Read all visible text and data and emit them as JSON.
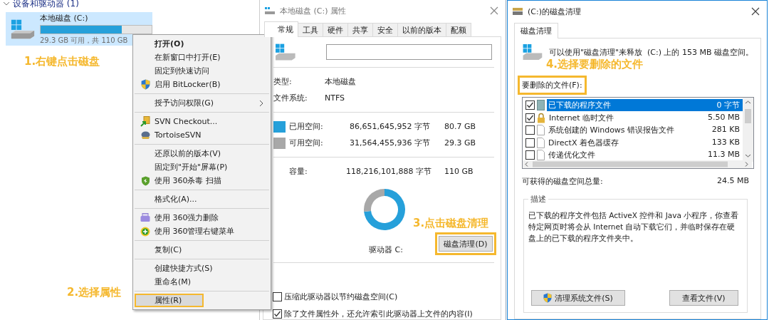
{
  "explorer": {
    "section_title": "设备和驱动器 (1)",
    "drive": {
      "name": "本地磁盘 (C:)",
      "level": 0.73,
      "space_text": "29.3 GB 可用，共 110 GB",
      "selected": true
    },
    "annotation": "1.右键点击磁盘"
  },
  "context_menu": {
    "annotation": "2.选择属性",
    "items": [
      {
        "kind": "plain",
        "label": "打开(O)",
        "bold": true,
        "selected": false
      },
      {
        "kind": "plain",
        "label": "在新窗口中打开(E)",
        "bold": false,
        "selected": false
      },
      {
        "kind": "plain",
        "label": "固定到快速访问",
        "bold": false,
        "selected": false
      },
      {
        "kind": "shield",
        "label": "启用 BitLocker(B)",
        "bold": false,
        "selected": false
      },
      {
        "kind": "separator"
      },
      {
        "kind": "submenu",
        "label": "授予访问权限(G)",
        "bold": false,
        "selected": false
      },
      {
        "kind": "separator"
      },
      {
        "kind": "checkout",
        "label": "SVN Checkout...",
        "bold": false,
        "selected": false
      },
      {
        "kind": "tortoise",
        "label": "TortoiseSVN",
        "bold": false,
        "selected": false
      },
      {
        "kind": "separator"
      },
      {
        "kind": "plain",
        "label": "还原以前的版本(V)",
        "bold": false,
        "selected": false
      },
      {
        "kind": "plain",
        "label": "固定到\"开始\"屏幕(P)",
        "bold": false,
        "selected": false
      },
      {
        "kind": "antivirus",
        "label": "使用 360杀毒 扫描",
        "bold": false,
        "selected": false
      },
      {
        "kind": "separator"
      },
      {
        "kind": "plain",
        "label": "格式化(A)...",
        "bold": false,
        "selected": false
      },
      {
        "kind": "separator"
      },
      {
        "kind": "shredder",
        "label": "使用 360强力删除",
        "bold": false,
        "selected": false
      },
      {
        "kind": "manager",
        "label": "使用 360管理右键菜单",
        "bold": false,
        "selected": false
      },
      {
        "kind": "separator"
      },
      {
        "kind": "plain",
        "label": "复制(C)",
        "bold": false,
        "selected": false
      },
      {
        "kind": "separator"
      },
      {
        "kind": "plain",
        "label": "创建快捷方式(S)",
        "bold": false,
        "selected": false
      },
      {
        "kind": "plain",
        "label": "重命名(M)",
        "bold": false,
        "selected": false
      },
      {
        "kind": "separator"
      },
      {
        "kind": "plain",
        "label": "属性(R)",
        "bold": false,
        "selected": true
      }
    ]
  },
  "properties": {
    "title": "本地磁盘 (C:) 属性",
    "tabs": [
      {
        "label": "常规",
        "selected": true
      },
      {
        "label": "工具",
        "selected": false
      },
      {
        "label": "硬件",
        "selected": false
      },
      {
        "label": "共享",
        "selected": false
      },
      {
        "label": "安全",
        "selected": false
      },
      {
        "label": "以前的版本",
        "selected": false
      },
      {
        "label": "配额",
        "selected": false
      }
    ],
    "info": [
      {
        "label": "类型:",
        "value": "本地磁盘"
      },
      {
        "label": "文件系统:",
        "value": "NTFS"
      }
    ],
    "space": [
      {
        "kind": "used",
        "label": "已用空间:",
        "bytes": "86,651,645,952 字节",
        "size": "80.7 GB"
      },
      {
        "kind": "free",
        "label": "可用空间:",
        "bytes": "31,564,455,936 字节",
        "size": "29.3 GB"
      }
    ],
    "capacity": {
      "label": "容量:",
      "bytes": "118,216,101,888 字节",
      "size": "110 GB"
    },
    "disk_chart": {
      "chart_data": {
        "type": "donut",
        "values": [
          73.4,
          26.6
        ]
      }
    },
    "drive_label": "驱动器 C:",
    "annotation": "3.点击磁盘清理",
    "cleanup_button": {
      "label": "磁盘清理(D)",
      "highlighted": true
    },
    "checkboxes": [
      {
        "label": "压缩此驱动器以节约磁盘空间(C)",
        "checked": false
      },
      {
        "label": "除了文件属性外，还允许索引此驱动器上文件的内容(I)",
        "checked": true
      }
    ]
  },
  "cleanup": {
    "title": "(C:)的磁盘清理",
    "tabs": [
      {
        "label": "磁盘清理",
        "selected": true
      }
    ],
    "message": "可以使用\"磁盘清理\"来释放  (C:) 上的 153 MB 磁盘空间。",
    "annotation": "4.选择要删除的文件",
    "list_label": {
      "text": "要删除的文件(F):",
      "highlighted": true
    },
    "files": [
      {
        "kind": "program",
        "name": "已下载的程序文件",
        "size": "0 字节",
        "checked": true,
        "selected": true
      },
      {
        "kind": "locked",
        "name": "Internet 临时文件",
        "size": "5.50 MB",
        "checked": true,
        "selected": false
      },
      {
        "kind": "document",
        "name": "系统创建的 Windows 错误报告文件",
        "size": "281 KB",
        "checked": false,
        "selected": false
      },
      {
        "kind": "document",
        "name": "DirectX 着色器缓存",
        "size": "133 KB",
        "checked": false,
        "selected": false
      },
      {
        "kind": "document",
        "name": "传递优化文件",
        "size": "11.3 MB",
        "checked": false,
        "selected": false
      }
    ],
    "total_label": "可获得的磁盘空间总量:",
    "total_value": "24.5 MB",
    "description_title": "描述",
    "description": "已下载的程序文件包括 ActiveX 控件和 Java 小程序，你查看特定网页时将会从 Internet 自动下载它们，并临时保存在硬盘上的已下载的程序文件夹中。",
    "buttons": [
      {
        "kind": "shield",
        "label": "清理系统文件(S)"
      },
      {
        "kind": "plain",
        "label": "查看文件(V)"
      }
    ]
  }
}
